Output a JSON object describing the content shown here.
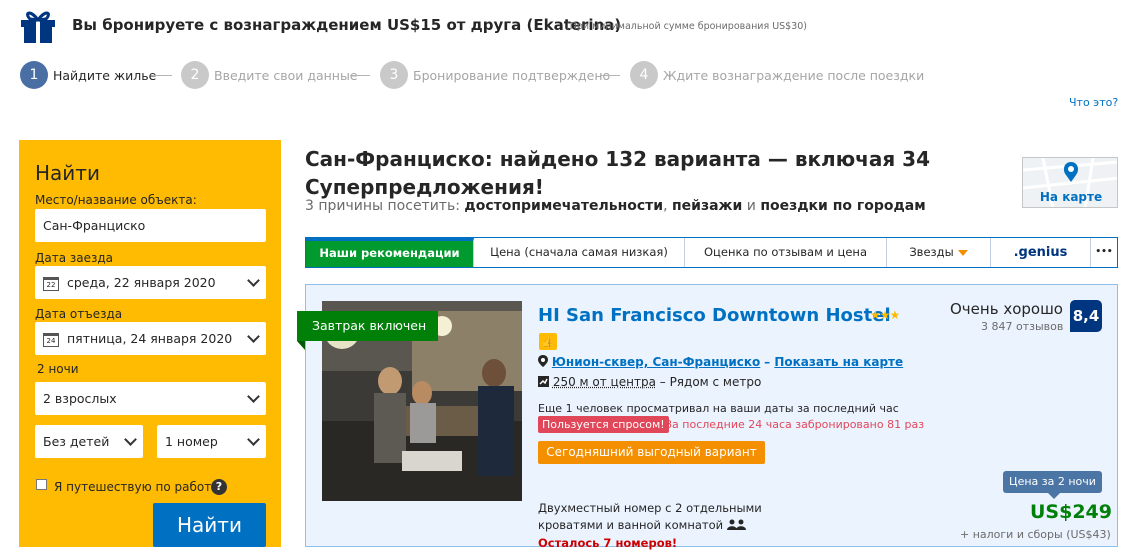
{
  "banner": {
    "title": "Вы бронируете с вознаграждением US$15 от друга (Ekaterina)",
    "note": "(При минимальной сумме бронирования US$30)"
  },
  "steps": [
    {
      "num": "1",
      "label": "Найдите жилье",
      "active": true
    },
    {
      "num": "2",
      "label": "Введите свои данные",
      "active": false
    },
    {
      "num": "3",
      "label": "Бронирование подтверждено",
      "active": false
    },
    {
      "num": "4",
      "label": "Ждите вознаграждение после поездки",
      "active": false
    }
  ],
  "whats_this": "Что это?",
  "search": {
    "title": "Найти",
    "destination_label": "Место/название объекта:",
    "destination_value": "Сан-Франциско",
    "checkin_label": "Дата заезда",
    "checkin_day": "22",
    "checkin_value": "среда, 22 января 2020",
    "checkout_label": "Дата отъезда",
    "checkout_day": "24",
    "checkout_value": "пятница, 24 января 2020",
    "nights": "2 ночи",
    "adults": "2 взрослых",
    "children": "Без детей",
    "rooms": "1 номер",
    "work_trip": "Я путешествую по работе",
    "help": "?",
    "button": "Найти"
  },
  "results": {
    "title": "Сан-Франциско: найдено 132 варианта — включая 34 Суперпредложения!",
    "reasons_prefix": "3 причины посетить:",
    "reason_1": "достопримечательности",
    "reason_2": "пейзажи",
    "reason_and": "и",
    "reason_3": "поездки по городам",
    "map_label": "На карте"
  },
  "sort": {
    "items": [
      "Наши рекомендации",
      "Цена (сначала самая низкая)",
      "Оценка по отзывам и цена",
      "Звезды",
      ".genius",
      "•••"
    ]
  },
  "property": {
    "ribbon": "Завтрак включен",
    "name": "HI San Francisco Downtown Hostel",
    "stars": "★★★",
    "location_link": "Юнион-сквер, Сан-Франциско",
    "map_link": "Показать на карте",
    "distance": "250 м от центра",
    "metro": "Рядом с метро",
    "viewers": "Еще 1 человек просматривал на ваши даты за последний час",
    "in_demand": "Пользуется спросом!",
    "booked": "За последние 24 часа забронировано 81 раз",
    "deal": "Сегодняшний выгодный вариант",
    "room_desc": "Двухместный номер с 2 отдельными кроватями и ванной комнатой",
    "rooms_left": "Осталось 7 номеров!",
    "score_word": "Очень хорошо",
    "reviews": "3 847 отзывов",
    "score": "8,4",
    "price_for": "Цена за 2 ночи",
    "price": "US$249",
    "taxes": "+ налоги и сборы (US$43)"
  },
  "colors": {
    "primary_blue": "#0071c2",
    "dark_blue": "#003580",
    "yellow": "#febb02",
    "green": "#008009",
    "orange": "#f48f00",
    "red": "#e0485a"
  }
}
